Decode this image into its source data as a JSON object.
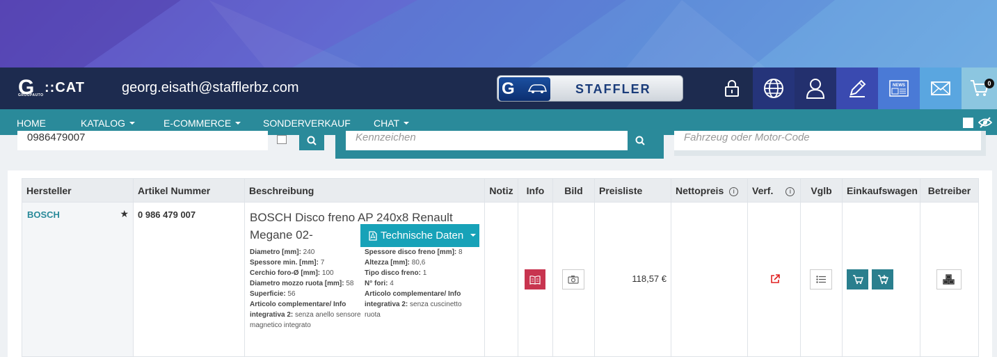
{
  "header": {
    "logo_g": "G",
    "logo_sub": "GROUPAUTO",
    "logo_cat": "::CAT",
    "user_email": "georg.eisath@stafflerbz.com",
    "brand_badge": "STAFFLER",
    "cart_count": "0"
  },
  "nav": {
    "home": "HOME",
    "katalog": "KATALOG",
    "ecommerce": "E-COMMERCE",
    "sonderverkauf": "SONDERVERKAUF",
    "chat": "CHAT"
  },
  "search": {
    "article_value": "0986479007",
    "plate_placeholder": "Kennzeichen",
    "vehicle_placeholder": "Fahrzeug oder Motor-Code"
  },
  "table": {
    "columns": [
      "Hersteller",
      "Artikel Nummer",
      "Beschreibung",
      "Notiz",
      "Info",
      "Bild",
      "Preisliste",
      "Nettopreis",
      "Verf.",
      "Vglb",
      "Einkaufswagen",
      "Betreiber"
    ],
    "info_symbol": "i",
    "row": {
      "manufacturer": "BOSCH",
      "article_number": "0 986 479 007",
      "title": "BOSCH Disco freno AP 240x8 Renault Megane 02-",
      "tech_button": "Technische Daten",
      "price_list": "118,57 €",
      "specs_left": [
        {
          "label": "Diametro [mm]:",
          "value": " 240"
        },
        {
          "label": "Spessore min. [mm]:",
          "value": " 7"
        },
        {
          "label": "Cerchio foro-Ø [mm]:",
          "value": " 100"
        },
        {
          "label": "Diametro mozzo ruota [mm]:",
          "value": " 58"
        },
        {
          "label": "Superficie:",
          "value": " 56"
        },
        {
          "label": "Articolo complementare/ Info integrativa 2:",
          "value": " senza anello sensore magnetico integrato"
        }
      ],
      "specs_right": [
        {
          "label": "Spessore disco freno [mm]:",
          "value": " 8"
        },
        {
          "label": "Altezza [mm]:",
          "value": " 80,6"
        },
        {
          "label": "Tipo disco freno:",
          "value": " 1"
        },
        {
          "label": "N° fori:",
          "value": " 4"
        },
        {
          "label": "Articolo complementare/ Info integrativa 2:",
          "value": " senza cuscinetto ruota"
        }
      ]
    }
  },
  "icons": [
    "lock-icon",
    "globe-icon",
    "user-icon",
    "edit-icon",
    "news-icon",
    "mail-icon",
    "cart-icon"
  ],
  "colors": {
    "navy": "#1d2b4f",
    "teal": "#2a8a9a",
    "button_teal": "#17a2b8",
    "info_red": "#c8344f"
  }
}
